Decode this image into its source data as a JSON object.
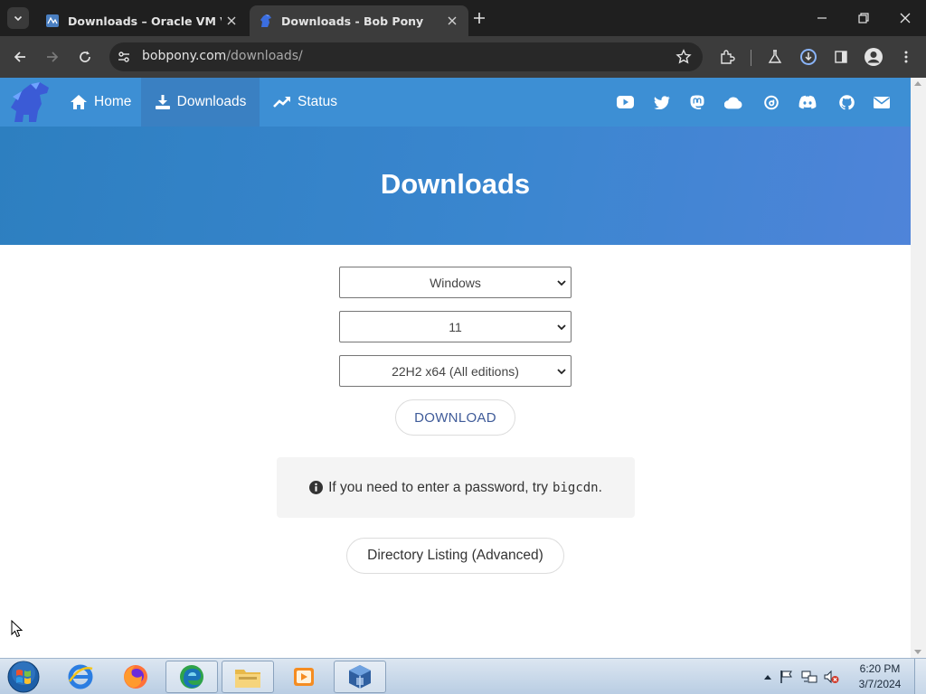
{
  "browser": {
    "tabs": [
      {
        "title": "Downloads – Oracle VM Virtua",
        "active": false
      },
      {
        "title": "Downloads - Bob Pony",
        "active": true
      }
    ],
    "address": {
      "host": "bobpony.com",
      "path": "/downloads/"
    }
  },
  "site": {
    "nav": [
      {
        "label": "Home",
        "icon": "home-icon"
      },
      {
        "label": "Downloads",
        "icon": "download-icon",
        "active": true
      },
      {
        "label": "Status",
        "icon": "trending-up-icon"
      }
    ],
    "social_icons": [
      "youtube-icon",
      "twitter-icon",
      "mastodon-icon",
      "cloud-icon",
      "threads-icon",
      "discord-icon",
      "github-icon",
      "mail-icon"
    ],
    "hero_title": "Downloads",
    "selects": {
      "os": "Windows",
      "version": "11",
      "edition": "22H2 x64 (All editions)"
    },
    "download_label": "DOWNLOAD",
    "notice": {
      "text": "If you need to enter a password, try",
      "code": "bigcdn",
      "suffix": "."
    },
    "directory_label": "Directory Listing (Advanced)"
  },
  "taskbar": {
    "apps": [
      "internet-explorer-icon",
      "firefox-icon",
      "edge-icon",
      "file-explorer-icon",
      "media-player-icon",
      "virtualbox-icon"
    ],
    "time": "6:20 PM",
    "date": "3/7/2024"
  },
  "colors": {
    "nav": "#3d8fd4",
    "hero": "#3a86cf",
    "accent": "#3f5b99"
  }
}
